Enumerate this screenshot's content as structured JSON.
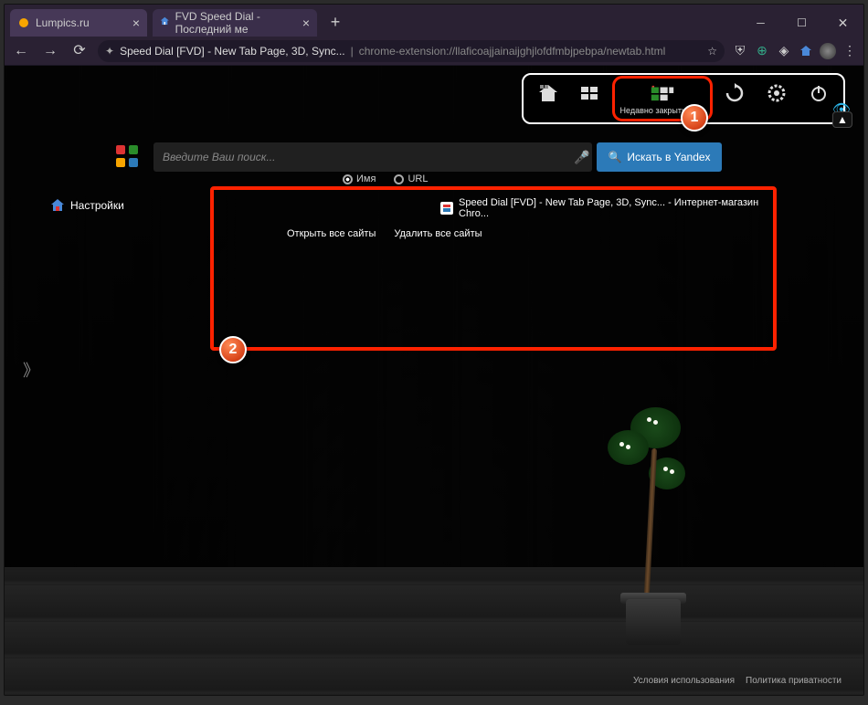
{
  "window": {
    "tabs": [
      {
        "title": "Lumpics.ru",
        "icon_color": "#f7a500"
      },
      {
        "title": "FVD Speed Dial - Последний ме",
        "icon_color": "#4a88d8"
      }
    ],
    "active_tab_index": 1
  },
  "addressbar": {
    "page_title": "Speed Dial [FVD] - New Tab Page, 3D, Sync...",
    "url": "chrome-extension://llaficoajjainaijghjlofdfmbjpebpa/newtab.html"
  },
  "toolbar": {
    "items": [
      {
        "name": "home",
        "label": ""
      },
      {
        "name": "popular",
        "label": ""
      },
      {
        "name": "recent",
        "label": "Недавно закрытые (2)"
      },
      {
        "name": "sync",
        "label": ""
      },
      {
        "name": "settings",
        "label": ""
      },
      {
        "name": "power",
        "label": ""
      }
    ]
  },
  "search": {
    "placeholder": "Введите Ваш поиск...",
    "button_label": "Искать в Yandex"
  },
  "sort": {
    "opt1": "Имя",
    "opt2": "URL"
  },
  "sidebar": {
    "settings_label": "Настройки"
  },
  "results": {
    "item_title": "Speed Dial [FVD] - New Tab Page, 3D, Sync... - Интернет-магазин Chro...",
    "open_all": "Открыть все сайты",
    "delete_all": "Удалить все сайты"
  },
  "badges": {
    "one": "1",
    "two": "2"
  },
  "footer": {
    "terms": "Условия использования",
    "privacy": "Политика приватности"
  }
}
